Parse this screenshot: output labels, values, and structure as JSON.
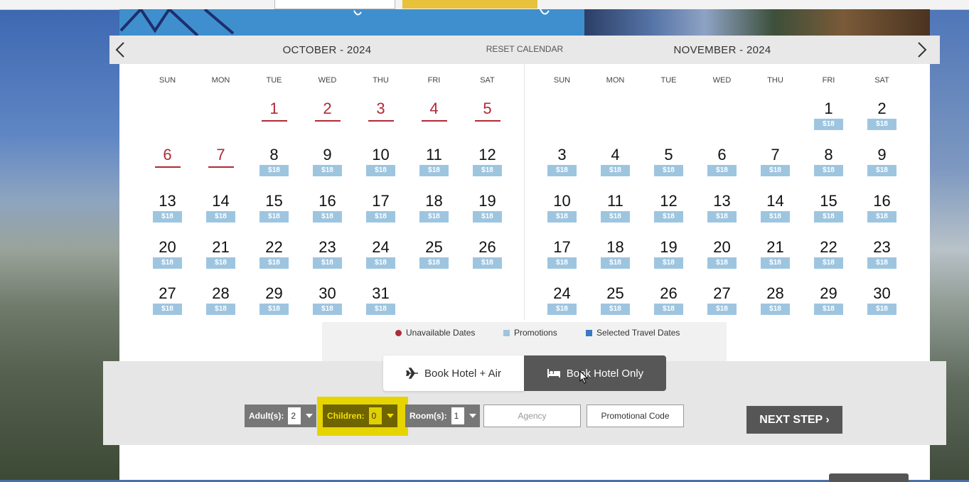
{
  "calendar": {
    "reset_label": "RESET CALENDAR",
    "prev_arrow": "‹",
    "next_arrow": "›",
    "weekdays": [
      "SUN",
      "MON",
      "TUE",
      "WED",
      "THU",
      "FRI",
      "SAT"
    ],
    "price_label": "$18",
    "months": [
      {
        "title": "OCTOBER - 2024",
        "first_weekday": 2,
        "days_in_month": 31,
        "unavailable_days": [
          1,
          2,
          3,
          4,
          5,
          6,
          7
        ]
      },
      {
        "title": "NOVEMBER - 2024",
        "first_weekday": 5,
        "days_in_month": 30,
        "unavailable_days": []
      }
    ]
  },
  "legend": {
    "unavailable": "Unavailable Dates",
    "promotions": "Promotions",
    "selected": "Selected Travel Dates"
  },
  "booking": {
    "tab_hotel_air": "Book Hotel + Air",
    "tab_hotel_only": "Book Hotel Only",
    "active_tab": "hotel_only",
    "adults_label": "Adult(s):",
    "adults_value": "2",
    "children_label": "Children:",
    "children_value": "0",
    "rooms_label": "Room(s):",
    "rooms_value": "1",
    "agency_placeholder": "Agency",
    "promo_placeholder": "Promotional Code",
    "next_step": "NEXT STEP ›"
  },
  "colors": {
    "unavailable": "#b02a37",
    "promotion": "#9ec5e0",
    "selected": "#3a78c2",
    "highlight": "#e6d400"
  },
  "icons": [
    "chevron-left-icon",
    "chevron-right-icon",
    "airplane-icon",
    "bed-icon",
    "caret-down-icon",
    "mouse-cursor-icon"
  ]
}
